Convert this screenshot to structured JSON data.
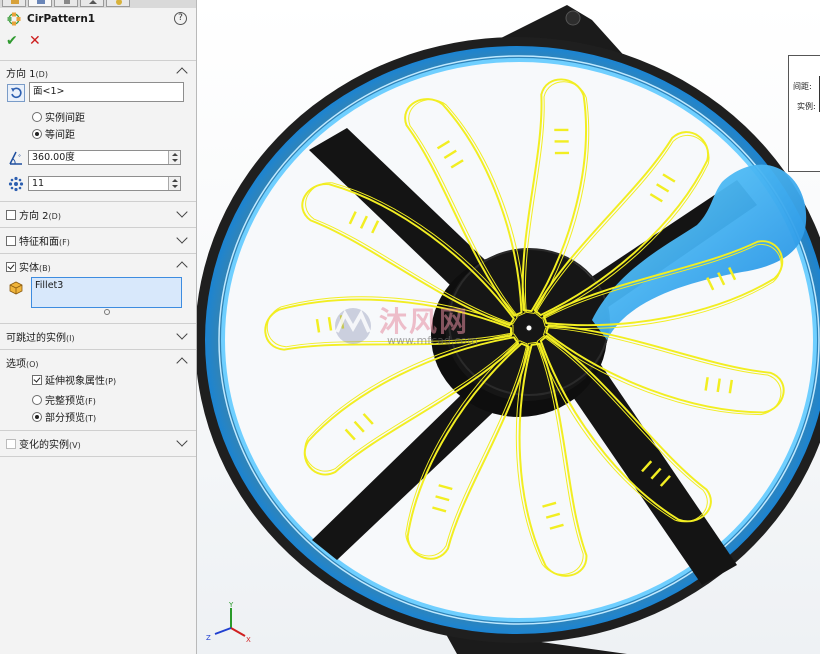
{
  "feature": {
    "title": "CirPattern1",
    "help": "?"
  },
  "actions": {
    "ok": "✔",
    "cancel": "✕"
  },
  "direction1": {
    "header": "方向 1",
    "header_key": "(D)",
    "ref_value": "面<1>",
    "options": [
      {
        "label": "实例间距",
        "selected": false
      },
      {
        "label": "等间距",
        "selected": true
      }
    ],
    "angle": "360.00度",
    "count": "11"
  },
  "direction2": {
    "label": "方向 2",
    "key": "(D)",
    "checked": false
  },
  "features_faces": {
    "label": "特征和面",
    "key": "(F)",
    "checked": false
  },
  "bodies": {
    "label": "实体",
    "key": "(B)",
    "checked": true,
    "items": [
      "Fillet3"
    ]
  },
  "skip_instances": {
    "label": "可跳过的实例",
    "key": "(I)"
  },
  "options": {
    "label": "选项",
    "key": "(O)",
    "propagate": {
      "label": "延伸视象属性",
      "key": "(P)",
      "checked": true
    },
    "preview": [
      {
        "label": "完整预览",
        "key": "(F)",
        "selected": false
      },
      {
        "label": "部分预览",
        "key": "(T)",
        "selected": true
      }
    ]
  },
  "vary_instances": {
    "label": "变化的实例",
    "key": "(V)",
    "checked": false
  },
  "callout": {
    "spacing_label": "间距:",
    "instances_label": "实例:"
  },
  "watermark": {
    "text": "沐风网",
    "url": "www.mfcad.com"
  },
  "triad": {
    "x": "X",
    "y": "Y",
    "z": "Z"
  },
  "colors": {
    "sketch": "#f2ee22",
    "glow": "#4fc3ff",
    "fan_frame": "#1b1b1b",
    "panel_bg": "#f3f3f3"
  }
}
